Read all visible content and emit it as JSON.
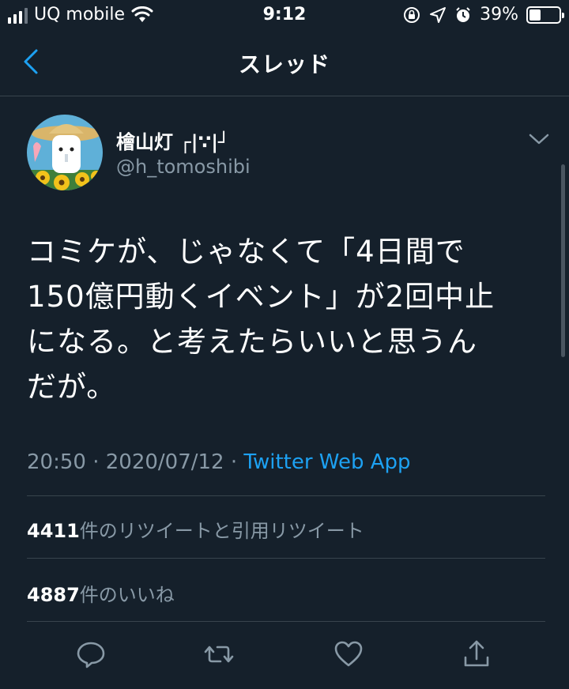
{
  "status_bar": {
    "carrier": "UQ mobile",
    "time": "9:12",
    "battery_text": "39%",
    "battery_level": 0.39,
    "icons": [
      "signal-icon",
      "wifi-icon",
      "orientation-lock-icon",
      "location-icon",
      "alarm-icon",
      "battery-icon"
    ]
  },
  "nav": {
    "title": "スレッド",
    "back_icon": "chevron-left-icon"
  },
  "tweet": {
    "display_name": "檜山灯 ┌|∵|┘",
    "username": "@h_tomoshibi",
    "text_lines": [
      "コミケが、じゃなくて「4日間で",
      "150億円動くイベント」が2回中止",
      "になる。と考えたらいいと思うん",
      "だが。"
    ],
    "time": "20:50",
    "date": "2020/07/12",
    "sep": "·",
    "source": "Twitter Web App",
    "retweets_count": "4411",
    "retweets_label": "件のリツイートと引用リツイート",
    "likes_count": "4887",
    "likes_label": "件のいいね"
  },
  "actions": [
    "reply-icon",
    "retweet-icon",
    "like-icon",
    "share-icon"
  ],
  "colors": {
    "background": "#15202b",
    "divider": "#38444d",
    "secondary_text": "#8899a6",
    "accent": "#1da1f2"
  }
}
